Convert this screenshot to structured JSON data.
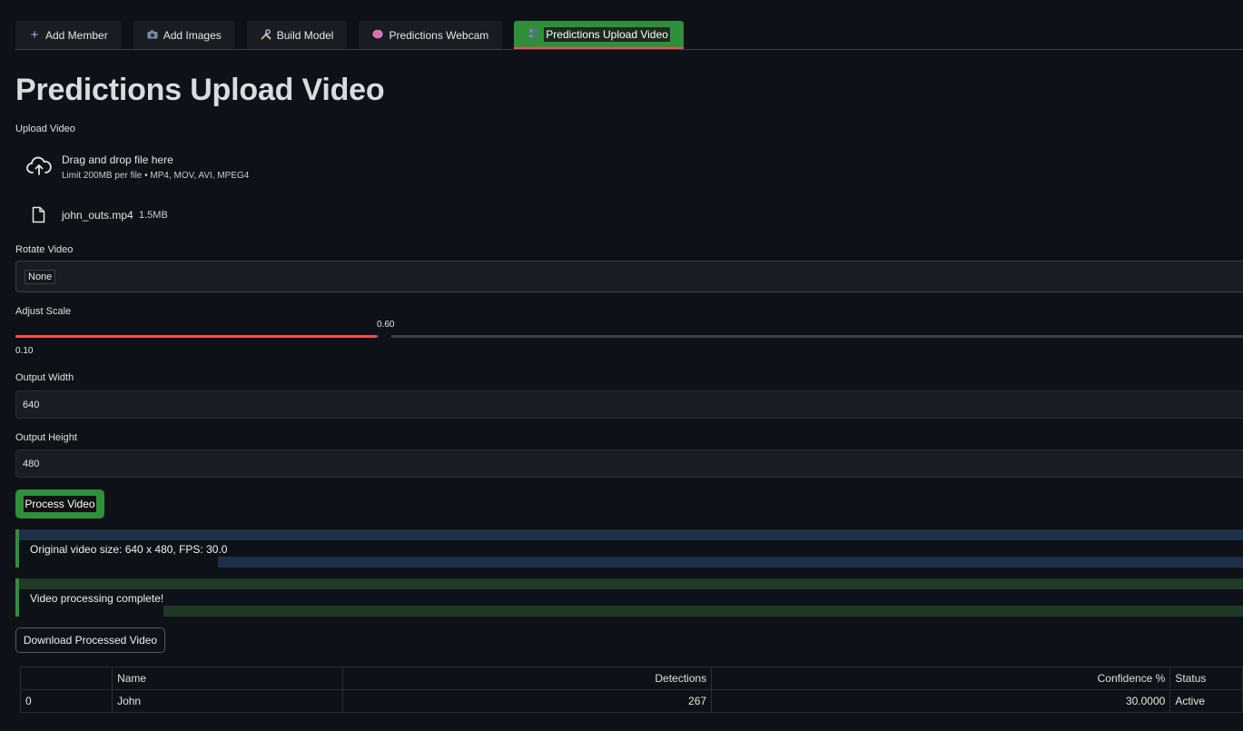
{
  "tabs": [
    {
      "icon": "plus-icon",
      "label": "Add Member",
      "active": false
    },
    {
      "icon": "camera-icon",
      "label": "Add Images",
      "active": false
    },
    {
      "icon": "tools-icon",
      "label": "Build Model",
      "active": false
    },
    {
      "icon": "brain-icon",
      "label": "Predictions Webcam",
      "active": false
    },
    {
      "icon": "people-icon",
      "label": "Predictions Upload Video",
      "active": true
    }
  ],
  "page": {
    "title": "Predictions Upload Video"
  },
  "upload": {
    "label": "Upload Video",
    "drag_text": "Drag and drop file here",
    "limit_text": "Limit 200MB per file • MP4, MOV, AVI, MPEG4",
    "file_name": "john_outs.mp4",
    "file_size": "1.5MB"
  },
  "rotate": {
    "label": "Rotate Video",
    "value": "None"
  },
  "scale": {
    "label": "Adjust Scale",
    "value": "0.60",
    "min": "0.10",
    "fill_fraction": 0.293
  },
  "output_width": {
    "label": "Output Width",
    "value": "640"
  },
  "output_height": {
    "label": "Output Height",
    "value": "480"
  },
  "process_button": "Process Video",
  "info_alert": {
    "text": "Original video size: 640 x 480, FPS: 30.0",
    "bg": "#1e3048",
    "border": "#2f8f3b"
  },
  "success_alert": {
    "text": "Video processing complete!",
    "bg": "#1e3a26",
    "border": "#2f8f3b"
  },
  "download_button": "Download Processed Video",
  "table": {
    "columns": [
      "",
      "Name",
      "Detections",
      "Confidence %",
      "Status"
    ],
    "rows": [
      [
        "0",
        "John",
        "267",
        "30.0000",
        "Active"
      ]
    ]
  },
  "colors": {
    "accent_green": "#2f8f3b",
    "accent_red": "#ff4b4b",
    "background": "#0e1117"
  }
}
